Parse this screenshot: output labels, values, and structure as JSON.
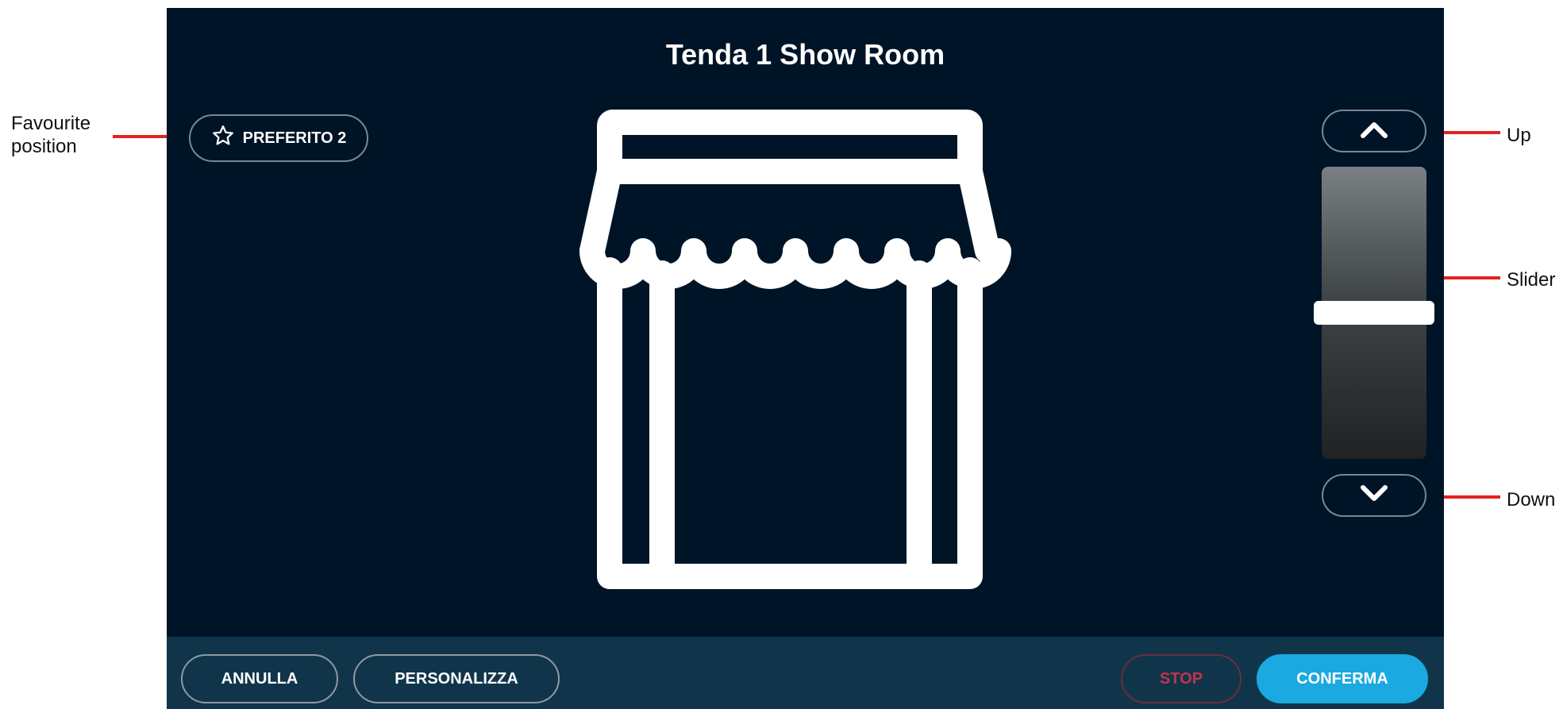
{
  "annotations": {
    "favourite_line1": "Favourite",
    "favourite_line2": "position",
    "up": "Up",
    "slider": "Slider",
    "down": "Down"
  },
  "screen": {
    "title": "Tenda 1 Show Room",
    "favourite_button": {
      "label": "PREFERITO 2",
      "icon": "star-outline-icon"
    },
    "up_button": {
      "icon": "chevron-up-icon"
    },
    "down_button": {
      "icon": "chevron-down-icon"
    },
    "slider": {
      "position_percent": 50
    },
    "awning_icon": "awning-shop-icon"
  },
  "bottom_bar": {
    "cancel": "ANNULLA",
    "customize": "PERSONALIZZA",
    "stop": "STOP",
    "confirm": "CONFERMA"
  },
  "colors": {
    "background": "#001427",
    "bottom_bar": "#10354a",
    "accent": "#1aa9e0",
    "stop": "#c0344b",
    "annotation_line": "#e02424"
  }
}
